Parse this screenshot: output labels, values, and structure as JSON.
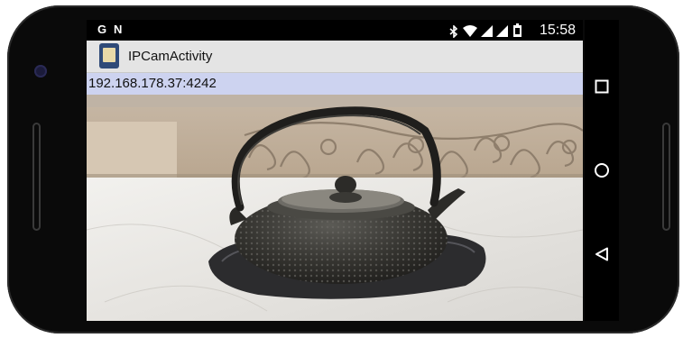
{
  "status_bar": {
    "left_icons": [
      "G",
      "N"
    ],
    "time": "15:58",
    "system_icons": [
      "bluetooth-icon",
      "wifi-icon",
      "signal-icon",
      "signal-icon-2",
      "battery-icon"
    ]
  },
  "action_bar": {
    "title": "IPCamActivity",
    "icon": "app-icon"
  },
  "url_bar": {
    "address": "192.168.178.37:4242"
  },
  "camera_feed": {
    "subject": "cast-iron-teapot-photo"
  },
  "navigation": {
    "buttons": [
      "recent-apps-icon",
      "home-icon",
      "back-icon"
    ]
  },
  "colors": {
    "action_bar": "#e4e4e4",
    "url_bar": "#cdd3f0",
    "bezel": "#0a0a0a"
  }
}
